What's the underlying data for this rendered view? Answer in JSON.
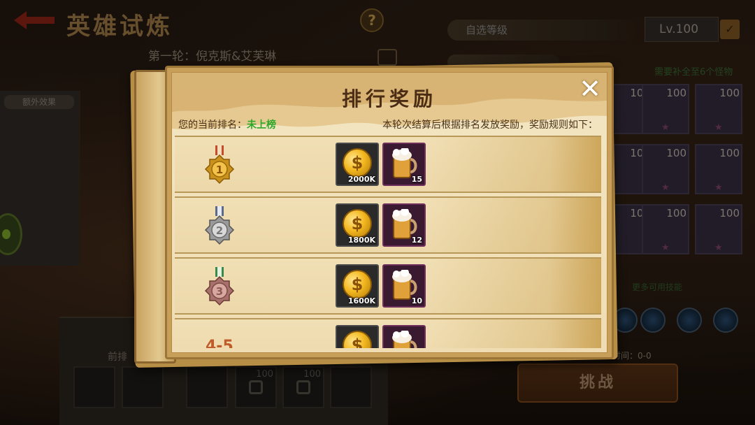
{
  "background": {
    "title": "英雄试炼",
    "help_icon": "?",
    "subtitle": "第一轮：倪克斯&艾芙琳",
    "level_select_label": "自选等级",
    "level_value": "Lv.100",
    "hint_text": "需要补全至6个怪物",
    "extra_effect_tab": "额外效果",
    "hero_level": "100",
    "front_row_label": "前排",
    "slot_level": "100",
    "challenge_button": "挑战",
    "time_text": "时间：0-0",
    "skill_hint": "更多可用技能"
  },
  "modal": {
    "title": "排行奖励",
    "close_icon": "✕",
    "current_rank_label": "您的当前排名：",
    "current_rank_value": "未上榜",
    "rule_text": "本轮次结算后根据排名发放奖励，奖励规则如下：",
    "rows": [
      {
        "rank_icon": "gold-medal-icon",
        "rank_number": "1",
        "gold": "2000K",
        "beer": "15"
      },
      {
        "rank_icon": "silver-medal-icon",
        "rank_number": "2",
        "gold": "1800K",
        "beer": "12"
      },
      {
        "rank_icon": "bronze-medal-icon",
        "rank_number": "3",
        "gold": "1600K",
        "beer": "10"
      },
      {
        "rank_text": "4-5",
        "gold": "",
        "beer": ""
      }
    ]
  },
  "colors": {
    "gold": "#f3b820",
    "silver": "#c8c8c8",
    "bronze": "#c08878",
    "rank_value_green": "#2ea82a"
  }
}
